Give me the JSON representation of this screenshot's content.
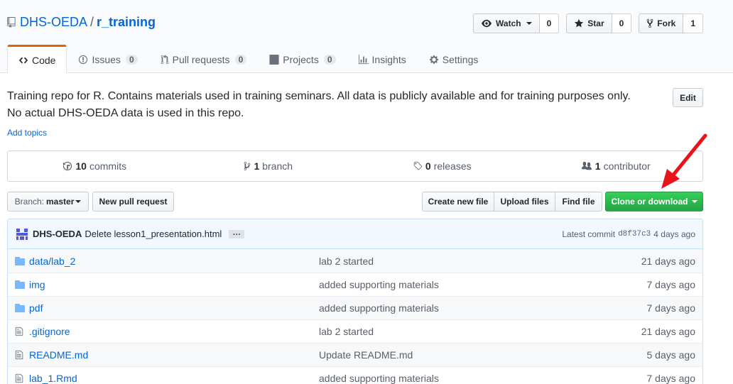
{
  "repo": {
    "owner": "DHS-OEDA",
    "separator": "/",
    "name": "r_training",
    "icon": "repo-icon"
  },
  "actions": {
    "watch": {
      "label": "Watch",
      "count": "0",
      "icon": "eye-icon"
    },
    "star": {
      "label": "Star",
      "count": "0",
      "icon": "star-icon"
    },
    "fork": {
      "label": "Fork",
      "count": "1",
      "icon": "fork-icon"
    }
  },
  "tabs": [
    {
      "label": "Code",
      "icon": "code-icon",
      "selected": true
    },
    {
      "label": "Issues",
      "count": "0",
      "icon": "issue-icon"
    },
    {
      "label": "Pull requests",
      "count": "0",
      "icon": "pull-request-icon"
    },
    {
      "label": "Projects",
      "count": "0",
      "icon": "project-icon"
    },
    {
      "label": "Insights",
      "icon": "graph-icon"
    },
    {
      "label": "Settings",
      "icon": "gear-icon"
    }
  ],
  "description": {
    "line1": "Training repo for R. Contains materials used in training seminars. All data is publicly available and for training purposes only.",
    "line2": "No actual DHS-OEDA data is used in this repo.",
    "edit_label": "Edit",
    "add_topics": "Add topics"
  },
  "summary": {
    "commits": {
      "count": "10",
      "label": "commits"
    },
    "branch": {
      "count": "1",
      "label": "branch"
    },
    "releases": {
      "count": "0",
      "label": "releases"
    },
    "contributors": {
      "count": "1",
      "label": "contributor"
    }
  },
  "file_nav": {
    "branch_label": "Branch:",
    "branch_value": "master",
    "new_pull_request": "New pull request",
    "create_new_file": "Create new file",
    "upload_files": "Upload files",
    "find_file": "Find file",
    "clone_or_download": "Clone or download"
  },
  "latest_commit": {
    "author": "DHS-OEDA",
    "message": "Delete lesson1_presentation.html",
    "expander": "…",
    "prefix": "Latest commit",
    "sha": "d8f37c3",
    "age": "4 days ago"
  },
  "files": [
    {
      "type": "dir",
      "name": "data/lab_2",
      "message": "lab 2 started",
      "age": "21 days ago"
    },
    {
      "type": "dir",
      "name": "img",
      "message": "added supporting materials",
      "age": "7 days ago"
    },
    {
      "type": "dir",
      "name": "pdf",
      "message": "added supporting materials",
      "age": "7 days ago"
    },
    {
      "type": "file",
      "name": ".gitignore",
      "message": "lab 2 started",
      "age": "21 days ago"
    },
    {
      "type": "file",
      "name": "README.md",
      "message": "Update README.md",
      "age": "5 days ago"
    },
    {
      "type": "file",
      "name": "lab_1.Rmd",
      "message": "added supporting materials",
      "age": "7 days ago"
    }
  ],
  "colors": {
    "link": "#0366d6",
    "selected_tab_accent": "#e36209",
    "primary_button": "#28a745",
    "annotation_arrow": "#e8141a"
  }
}
